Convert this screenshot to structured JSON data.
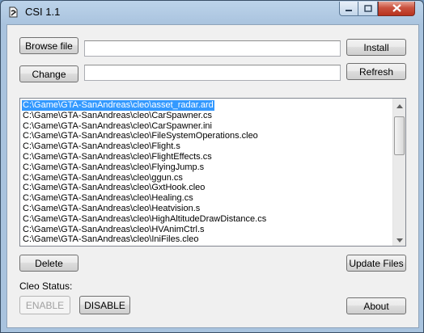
{
  "window": {
    "title": "CSI 1.1"
  },
  "buttons": {
    "browse": "Browse file",
    "change": "Change",
    "install": "Install",
    "refresh": "Refresh",
    "delete": "Delete",
    "update_files": "Update Files",
    "enable": "ENABLE",
    "disable": "DISABLE",
    "about": "About"
  },
  "fields": {
    "browse_path": "",
    "change_path": ""
  },
  "files": [
    "C:\\Game\\GTA-SanAndreas\\cleo\\asset_radar.ard",
    "C:\\Game\\GTA-SanAndreas\\cleo\\CarSpawner.cs",
    "C:\\Game\\GTA-SanAndreas\\cleo\\CarSpawner.ini",
    "C:\\Game\\GTA-SanAndreas\\cleo\\FileSystemOperations.cleo",
    "C:\\Game\\GTA-SanAndreas\\cleo\\Flight.s",
    "C:\\Game\\GTA-SanAndreas\\cleo\\FlightEffects.cs",
    "C:\\Game\\GTA-SanAndreas\\cleo\\FlyingJump.s",
    "C:\\Game\\GTA-SanAndreas\\cleo\\ggun.cs",
    "C:\\Game\\GTA-SanAndreas\\cleo\\GxtHook.cleo",
    "C:\\Game\\GTA-SanAndreas\\cleo\\Healing.cs",
    "C:\\Game\\GTA-SanAndreas\\cleo\\Heatvision.s",
    "C:\\Game\\GTA-SanAndreas\\cleo\\HighAltitudeDrawDistance.cs",
    "C:\\Game\\GTA-SanAndreas\\cleo\\HVAnimCtrl.s",
    "C:\\Game\\GTA-SanAndreas\\cleo\\IniFiles.cleo"
  ],
  "selected_index": 0,
  "cleo_status": {
    "label": "Cleo Status:",
    "enable_disabled": true
  },
  "colors": {
    "selection": "#3399ff",
    "close_button": "#c9523f"
  },
  "icons": [
    "app-icon",
    "minimize-icon",
    "maximize-icon",
    "close-icon",
    "scroll-up-icon",
    "scroll-down-icon"
  ]
}
